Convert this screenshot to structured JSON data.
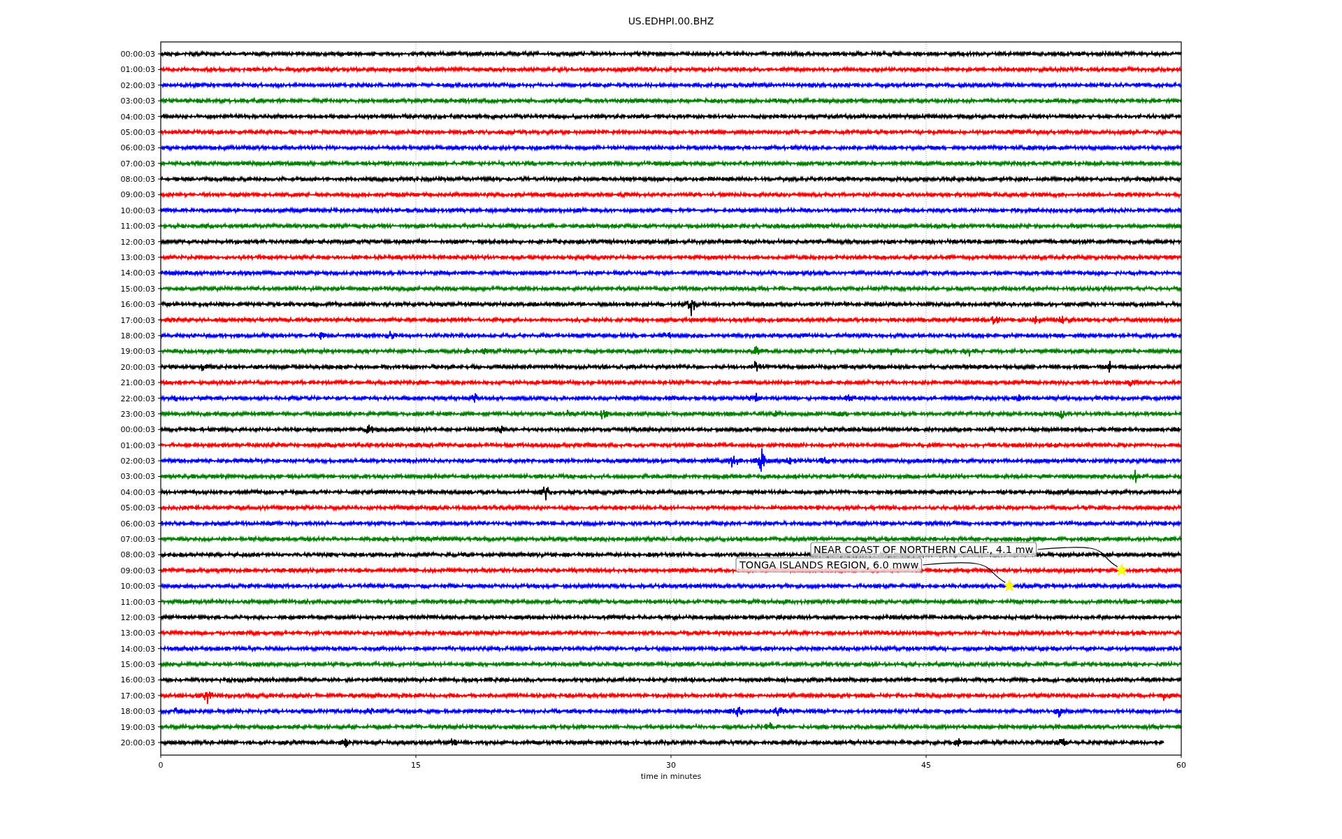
{
  "plot": {
    "title": "US.EDHPI.00.BHZ",
    "traces": [
      {
        "label": "00:00:03",
        "color": "#000000"
      },
      {
        "label": "01:00:03",
        "color": "#ff0000"
      },
      {
        "label": "02:00:03",
        "color": "#0000ff"
      },
      {
        "label": "03:00:03",
        "color": "#008000"
      },
      {
        "label": "04:00:03",
        "color": "#000000"
      },
      {
        "label": "05:00:03",
        "color": "#ff0000"
      },
      {
        "label": "06:00:03",
        "color": "#0000ff"
      },
      {
        "label": "07:00:03",
        "color": "#008000"
      },
      {
        "label": "08:00:03",
        "color": "#000000"
      },
      {
        "label": "09:00:03",
        "color": "#ff0000"
      },
      {
        "label": "10:00:03",
        "color": "#0000ff"
      },
      {
        "label": "11:00:03",
        "color": "#008000"
      },
      {
        "label": "12:00:03",
        "color": "#000000"
      },
      {
        "label": "13:00:03",
        "color": "#ff0000"
      },
      {
        "label": "14:00:03",
        "color": "#0000ff"
      },
      {
        "label": "15:00:03",
        "color": "#008000"
      },
      {
        "label": "16:00:03",
        "color": "#000000"
      },
      {
        "label": "17:00:03",
        "color": "#ff0000"
      },
      {
        "label": "18:00:03",
        "color": "#0000ff"
      },
      {
        "label": "19:00:03",
        "color": "#008000"
      },
      {
        "label": "20:00:03",
        "color": "#000000"
      },
      {
        "label": "21:00:03",
        "color": "#ff0000"
      },
      {
        "label": "22:00:03",
        "color": "#0000ff"
      },
      {
        "label": "23:00:03",
        "color": "#008000"
      },
      {
        "label": "00:00:03",
        "color": "#000000"
      },
      {
        "label": "01:00:03",
        "color": "#ff0000"
      },
      {
        "label": "02:00:03",
        "color": "#0000ff"
      },
      {
        "label": "03:00:03",
        "color": "#008000"
      },
      {
        "label": "04:00:03",
        "color": "#000000"
      },
      {
        "label": "05:00:03",
        "color": "#ff0000"
      },
      {
        "label": "06:00:03",
        "color": "#0000ff"
      },
      {
        "label": "07:00:03",
        "color": "#008000"
      },
      {
        "label": "08:00:03",
        "color": "#000000"
      },
      {
        "label": "09:00:03",
        "color": "#ff0000"
      },
      {
        "label": "10:00:03",
        "color": "#0000ff"
      },
      {
        "label": "11:00:03",
        "color": "#008000"
      },
      {
        "label": "12:00:03",
        "color": "#000000"
      },
      {
        "label": "13:00:03",
        "color": "#ff0000"
      },
      {
        "label": "14:00:03",
        "color": "#0000ff"
      },
      {
        "label": "15:00:03",
        "color": "#008000"
      },
      {
        "label": "16:00:03",
        "color": "#000000"
      },
      {
        "label": "17:00:03",
        "color": "#ff0000"
      },
      {
        "label": "18:00:03",
        "color": "#0000ff"
      },
      {
        "label": "19:00:03",
        "color": "#008000"
      },
      {
        "label": "20:00:03",
        "color": "#000000"
      }
    ],
    "x_ticks": [
      "0",
      "15",
      "30",
      "45",
      "60"
    ],
    "x_title": "time in minutes",
    "events": [
      {
        "text": "NEAR COAST OF NORTHERN CALIF., 4.1 mw"
      },
      {
        "text": "TONGA ISLANDS REGION, 6.0 mww"
      }
    ]
  }
}
